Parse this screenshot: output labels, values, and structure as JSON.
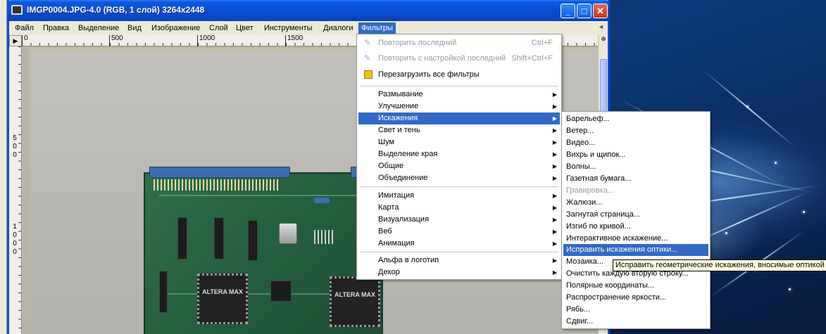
{
  "window": {
    "title": "IMGP0004.JPG-4.0 (RGB, 1 слой) 3264x2448",
    "controls": {
      "minimize": "_",
      "maximize": "□",
      "close": "✕"
    }
  },
  "menubar": {
    "items": [
      "Файл",
      "Правка",
      "Выделение",
      "Вид",
      "Изображение",
      "Слой",
      "Цвет",
      "Инструменты",
      "Диалоги",
      "Фильтры"
    ],
    "active": "Фильтры"
  },
  "ruler": {
    "top_labels": [
      "0",
      "500",
      "1000",
      "1500"
    ],
    "left_labels": [
      "5",
      "0",
      "0",
      "1",
      "0",
      "0",
      "0"
    ]
  },
  "filters_menu": {
    "repeat_last": "Повторить последний",
    "repeat_last_shortcut": "Ctrl+F",
    "reshow_last": "Повторить с настройкой последний",
    "reshow_last_shortcut": "Shift+Ctrl+F",
    "reset_all": "Перезагрузить все фильтры",
    "group1": [
      "Размывание",
      "Улучшение",
      "Искажения",
      "Свет и тень",
      "Шум",
      "Выделение края",
      "Общие",
      "Объединение"
    ],
    "group2": [
      "Имитация",
      "Карта",
      "Визуализация",
      "Веб",
      "Анимация"
    ],
    "group3": [
      "Альфа в логотип",
      "Декор"
    ],
    "highlighted": "Искажения"
  },
  "distort_menu": {
    "items": [
      "Барельеф...",
      "Ветер...",
      "Видео...",
      "Вихрь и щипок...",
      "Волны...",
      "Газетная бумага...",
      "Гравировка...",
      "Жалюзи...",
      "Загнутая страница...",
      "Изгиб по кривой...",
      "Интерактивное искажение...",
      "Исправить искажения оптики...",
      "Мозаика...",
      "Очистить каждую вторую строку...",
      "Полярные координаты...",
      "Распространение яркости...",
      "Рябь...",
      "Сдвиг..."
    ],
    "disabled": "Гравировка...",
    "highlighted": "Исправить искажения оптики..."
  },
  "tooltip": "Исправить геометрические искажения, вносимые оптикой",
  "canvas": {
    "chip_label_1": "ALTERA MAX",
    "chip_label_2": "ALTERA MAX"
  }
}
